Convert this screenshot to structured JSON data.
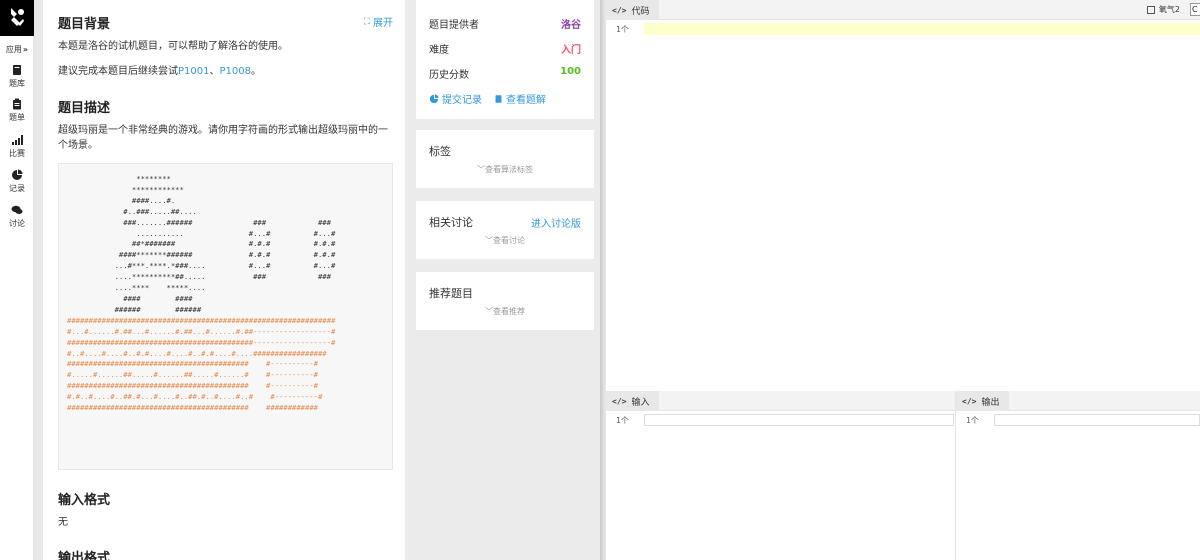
{
  "nav": {
    "app_label": "应用",
    "items": [
      {
        "label": "题库",
        "icon": "book-icon"
      },
      {
        "label": "题单",
        "icon": "clipboard-icon"
      },
      {
        "label": "比赛",
        "icon": "signal-bars-icon"
      },
      {
        "label": "记录",
        "icon": "pie-chart-icon"
      },
      {
        "label": "讨论",
        "icon": "chat-bubbles-icon"
      }
    ]
  },
  "problem": {
    "expand_label": "展开",
    "background_title": "题目背景",
    "background_text": "本题是洛谷的试机题目，可以帮助了解洛谷的使用。",
    "suggest_prefix": "建议完成本题目后继续尝试",
    "suggest_link1": "P1001",
    "suggest_sep": "、",
    "suggest_link2": "P1008",
    "suggest_suffix": "。",
    "description_title": "题目描述",
    "description_line1": "超级玛丽是一个非常经典的游戏。请你用字符画的形式输出超级玛丽中的一",
    "description_line2": "个场景。",
    "ascii_black": [
      "                ********",
      "               ************",
      "               ####....#.",
      "             #..###.....##....",
      "             ###.......######              ###            ###",
      "                ...........               #...#          #...#",
      "               ##*#######                 #.#.#          #.#.#",
      "            ####*******######             #.#.#          #.#.#",
      "           ...#***.****.*###....          #...#          #...#",
      "           ....**********##.....           ###            ###",
      "           ....****    *****....",
      "             ####        ####",
      "           ######        ######"
    ],
    "ascii_orange": [
      "##############################################################",
      "#...#......#.##...#......#.##...#......#.##------------------#",
      "###########################################------------------#",
      "#..#....#....#..#.#....#....#..#.#....#....#################",
      "##########################################    #----------#",
      "#.....#......##.....#......##.....#......#    #----------#",
      "##########################################    #----------#",
      "#.#..#....#..##.#...#....#..##.#..#....#..#    #----------#",
      "##########################################    ############"
    ],
    "input_title": "输入格式",
    "input_text": "无",
    "output_title": "输出格式"
  },
  "info": {
    "provider_label": "题目提供者",
    "provider_value": "洛谷",
    "difficulty_label": "难度",
    "difficulty_value": "入门",
    "score_label": "历史分数",
    "score_value": "100",
    "submit_records": "提交记录",
    "view_solution": "查看题解"
  },
  "tags": {
    "title": "标签",
    "sub": "查看算法标签"
  },
  "discuss": {
    "title": "相关讨论",
    "enter": "进入讨论版",
    "sub": "查看讨论"
  },
  "recommend": {
    "title": "推荐题目",
    "sub": "查看推荐"
  },
  "ide": {
    "code_tab": "代码",
    "o2_label": "氧气2",
    "line1": "1个",
    "input_tab": "输入",
    "output_tab": "输出"
  },
  "colors": {
    "provider": "#8e44ad",
    "difficulty": "#fe4c61",
    "score": "#52c41a",
    "link": "#3498db",
    "ascii_orange": "#e98a4e",
    "code_highlight": "#ffffcc"
  }
}
